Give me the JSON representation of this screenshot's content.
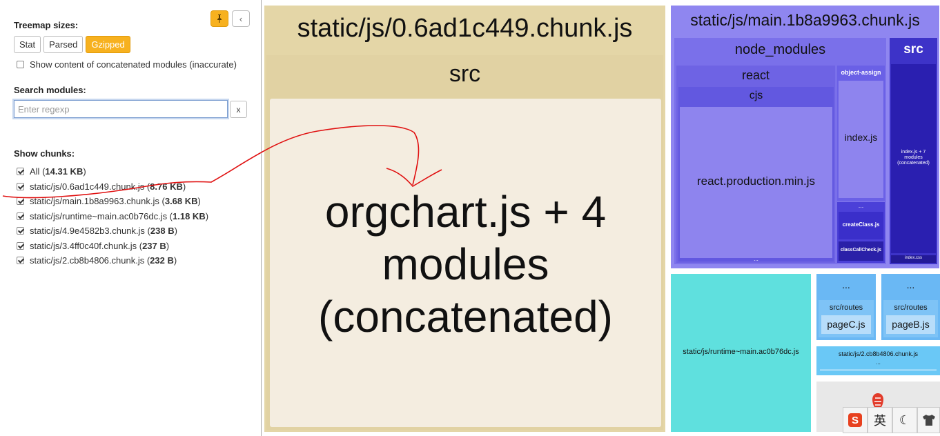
{
  "sidebar": {
    "pin_icon": "pin-icon",
    "collapse_icon": "chevron-left-icon",
    "treemap_sizes_label": "Treemap sizes:",
    "size_options": [
      "Stat",
      "Parsed",
      "Gzipped"
    ],
    "active_size": "Gzipped",
    "concat_checkbox_label": "Show content of concatenated modules (inaccurate)",
    "search_label": "Search modules:",
    "search_placeholder": "Enter regexp",
    "search_clear": "x",
    "show_chunks_label": "Show chunks:",
    "chunks": [
      {
        "name": "All",
        "size": "14.31 KB"
      },
      {
        "name": "static/js/0.6ad1c449.chunk.js",
        "size": "8.76 KB"
      },
      {
        "name": "static/js/main.1b8a9963.chunk.js",
        "size": "3.68 KB"
      },
      {
        "name": "static/js/runtime~main.ac0b76dc.js",
        "size": "1.18 KB"
      },
      {
        "name": "static/js/4.9e4582b3.chunk.js",
        "size": "238 B"
      },
      {
        "name": "static/js/3.4ff0c40f.chunk.js",
        "size": "237 B"
      },
      {
        "name": "static/js/2.cb8b4806.chunk.js",
        "size": "232 B"
      }
    ]
  },
  "treemap": {
    "chunk0": {
      "title": "static/js/0.6ad1c449.chunk.js",
      "folder": "src",
      "module_line1": "orgchart.js + 4",
      "module_line2": "modules",
      "module_line3": "(concatenated)"
    },
    "main": {
      "title": "static/js/main.1b8a9963.chunk.js",
      "node_modules": "node_modules",
      "react": "react",
      "cjs": "cjs",
      "react_min": "react.production.min.js",
      "object_assign": "object-assign",
      "object_assign_index": "index.js",
      "ellipsis": "...",
      "create_class": "createClass.js",
      "class_call_check": "classCallCheck.js",
      "src": "src",
      "src_index": "index.js + 7",
      "src_index2": "modules",
      "src_index3": "(concatenated)",
      "index_css": "index.css"
    },
    "runtime": {
      "title": "static/js/runtime~main.ac0b76dc.js"
    },
    "chunk4": {
      "ellipsis": "...",
      "folder": "src/routes",
      "file": "pageC.js"
    },
    "chunk3": {
      "ellipsis": "...",
      "folder": "src/routes",
      "file": "pageB.js"
    },
    "chunk2": {
      "title": "static/js/2.cb8b4806.chunk.js",
      "ellipsis": "..."
    }
  },
  "ime_toolbar": {
    "sogou_icon": "sogou-s-icon",
    "lang": "英",
    "moon_icon": "moon-icon",
    "shirt_icon": "shirt-icon"
  },
  "colors": {
    "accent": "#f7b11f",
    "chunk0": "#e4d6a7",
    "chunk0_inner": "#f4ede0",
    "main": "#8f86f0",
    "runtime": "#5fe0de",
    "small_chunks": "#6ab8f4"
  }
}
